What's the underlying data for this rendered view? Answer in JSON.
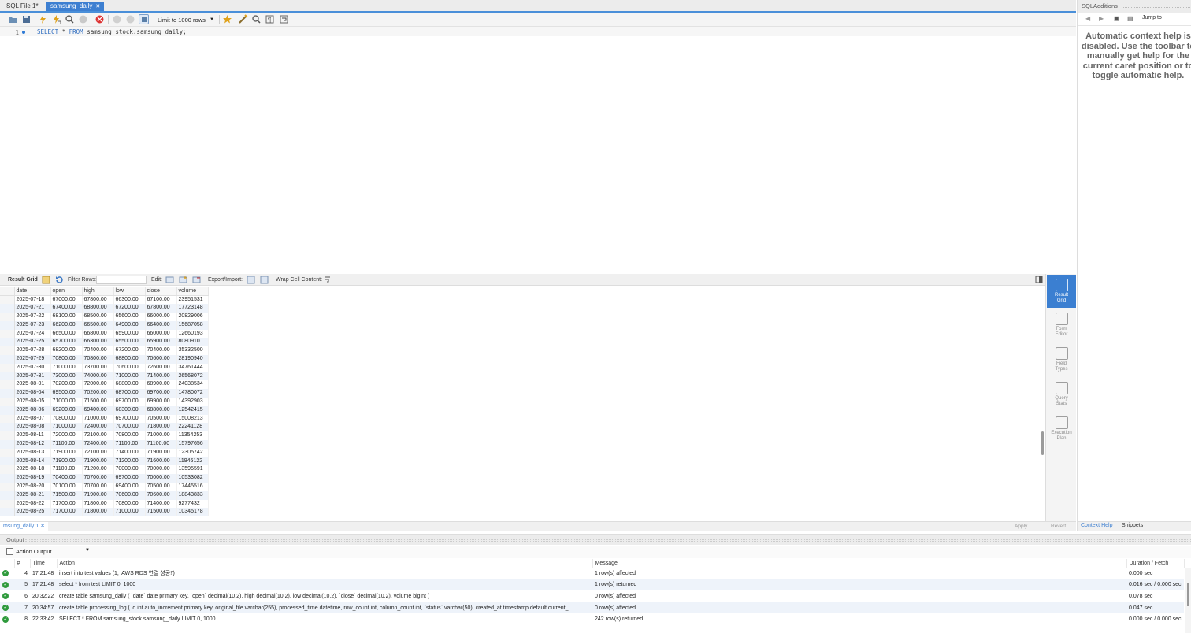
{
  "editor_tabs": [
    {
      "label": "SQL File 1*",
      "active": false
    },
    {
      "label": "samsung_daily",
      "active": true
    }
  ],
  "toolbar": {
    "limit_label": "Limit to 1000 rows",
    "icons": [
      "open-file-icon",
      "save-icon",
      "execute-icon",
      "execute-current-icon",
      "explain-icon",
      "stop-icon",
      "toggle-error-icon",
      "commit-icon",
      "rollback-icon",
      "autocommit-icon",
      "add-snippet-icon",
      "beautify-icon",
      "find-icon",
      "invisible-chars-icon",
      "word-wrap-icon"
    ]
  },
  "editor": {
    "line_number": "1",
    "code_keyword1": "SELECT",
    "code_star": " * ",
    "code_keyword2": "FROM",
    "code_rest": " samsung_stock.samsung_daily;"
  },
  "result_toolbar": {
    "result_grid": "Result Grid",
    "filter_rows": "Filter Rows:",
    "edit": "Edit:",
    "export_import": "Export/Import:",
    "wrap_cell": "Wrap Cell Content:"
  },
  "grid": {
    "columns": [
      "date",
      "open",
      "high",
      "low",
      "close",
      "volume"
    ],
    "rows": [
      [
        "2025-07-18",
        "67000.00",
        "67800.00",
        "66300.00",
        "67100.00",
        "23951531"
      ],
      [
        "2025-07-21",
        "67400.00",
        "68800.00",
        "67200.00",
        "67800.00",
        "17723148"
      ],
      [
        "2025-07-22",
        "68100.00",
        "68500.00",
        "65600.00",
        "66000.00",
        "20829006"
      ],
      [
        "2025-07-23",
        "66200.00",
        "66500.00",
        "64900.00",
        "66400.00",
        "15687058"
      ],
      [
        "2025-07-24",
        "66500.00",
        "66800.00",
        "65900.00",
        "66000.00",
        "12660193"
      ],
      [
        "2025-07-25",
        "65700.00",
        "66300.00",
        "65500.00",
        "65900.00",
        "8080910"
      ],
      [
        "2025-07-28",
        "68200.00",
        "70400.00",
        "67200.00",
        "70400.00",
        "35332500"
      ],
      [
        "2025-07-29",
        "70800.00",
        "70800.00",
        "68800.00",
        "70600.00",
        "28190940"
      ],
      [
        "2025-07-30",
        "71000.00",
        "73700.00",
        "70600.00",
        "72600.00",
        "34761444"
      ],
      [
        "2025-07-31",
        "73000.00",
        "74000.00",
        "71000.00",
        "71400.00",
        "26568072"
      ],
      [
        "2025-08-01",
        "70200.00",
        "72000.00",
        "68800.00",
        "68900.00",
        "24038534"
      ],
      [
        "2025-08-04",
        "69500.00",
        "70200.00",
        "68700.00",
        "69700.00",
        "14780072"
      ],
      [
        "2025-08-05",
        "71000.00",
        "71500.00",
        "69700.00",
        "69900.00",
        "14392903"
      ],
      [
        "2025-08-06",
        "69200.00",
        "69400.00",
        "68300.00",
        "68800.00",
        "12542415"
      ],
      [
        "2025-08-07",
        "70800.00",
        "71000.00",
        "69700.00",
        "70500.00",
        "15008213"
      ],
      [
        "2025-08-08",
        "71000.00",
        "72400.00",
        "70700.00",
        "71800.00",
        "22241128"
      ],
      [
        "2025-08-11",
        "72000.00",
        "72100.00",
        "70800.00",
        "71000.00",
        "11354253"
      ],
      [
        "2025-08-12",
        "71100.00",
        "72400.00",
        "71100.00",
        "71100.00",
        "15797656"
      ],
      [
        "2025-08-13",
        "71900.00",
        "72100.00",
        "71400.00",
        "71900.00",
        "12305742"
      ],
      [
        "2025-08-14",
        "71900.00",
        "71900.00",
        "71200.00",
        "71600.00",
        "11946122"
      ],
      [
        "2025-08-18",
        "71100.00",
        "71200.00",
        "70000.00",
        "70000.00",
        "13595591"
      ],
      [
        "2025-08-19",
        "70400.00",
        "70700.00",
        "69700.00",
        "70000.00",
        "10533082"
      ],
      [
        "2025-08-20",
        "70100.00",
        "70700.00",
        "69400.00",
        "70500.00",
        "17445516"
      ],
      [
        "2025-08-21",
        "71500.00",
        "71900.00",
        "70600.00",
        "70600.00",
        "18843833"
      ],
      [
        "2025-08-22",
        "71700.00",
        "71800.00",
        "70800.00",
        "71400.00",
        "9277432"
      ],
      [
        "2025-08-25",
        "71700.00",
        "71800.00",
        "71000.00",
        "71500.00",
        "10345178"
      ]
    ]
  },
  "side_panel": [
    {
      "label1": "Result",
      "label2": "Grid",
      "active": true
    },
    {
      "label1": "Form",
      "label2": "Editor",
      "active": false
    },
    {
      "label1": "Field",
      "label2": "Types",
      "active": false
    },
    {
      "label1": "Query",
      "label2": "Stats",
      "active": false
    },
    {
      "label1": "Execution",
      "label2": "Plan",
      "active": false
    }
  ],
  "result_tab": "msung_daily 1",
  "apply_label": "Apply",
  "revert_label": "Revert",
  "right_panel": {
    "title": "SQLAdditions",
    "jump_to": "Jump to",
    "help_text": "Automatic context help is disabled. Use the toolbar to manually get help for the current caret position or to toggle automatic help.",
    "tab_context": "Context Help",
    "tab_snippets": "Snippets"
  },
  "output": {
    "title": "Output",
    "select": "Action Output",
    "columns": [
      "#",
      "Time",
      "Action",
      "Message",
      "Duration / Fetch"
    ],
    "rows": [
      {
        "n": "4",
        "time": "17:21:48",
        "action": "insert into test values (1, 'AWS RDS 연결 성공!')",
        "message": "1 row(s) affected",
        "duration": "0.000 sec"
      },
      {
        "n": "5",
        "time": "17:21:48",
        "action": "select * from test LIMIT 0, 1000",
        "message": "1 row(s) returned",
        "duration": "0.016 sec / 0.000 sec"
      },
      {
        "n": "6",
        "time": "20:32:22",
        "action": "create table samsung_daily ( `date` date primary key,     `open` decimal(10,2),     high decimal(10,2),     low decimal(10,2),     `close` decimal(10,2),     volume bigint )",
        "message": "0 row(s) affected",
        "duration": "0.078 sec"
      },
      {
        "n": "7",
        "time": "20:34:57",
        "action": "create table processing_log ( id int auto_increment primary key,     original_file varchar(255),     processed_time datetime,     row_count int,     column_count int,     `status` varchar(50),     created_at timestamp default current_...",
        "message": "0 row(s) affected",
        "duration": "0.047 sec"
      },
      {
        "n": "8",
        "time": "22:33:42",
        "action": "SELECT * FROM samsung_stock.samsung_daily LIMIT 0, 1000",
        "message": "242 row(s) returned",
        "duration": "0.000 sec / 0.000 sec"
      }
    ]
  },
  "colors": {
    "accent": "#3d7fd1",
    "ok": "#2e9a3c"
  }
}
